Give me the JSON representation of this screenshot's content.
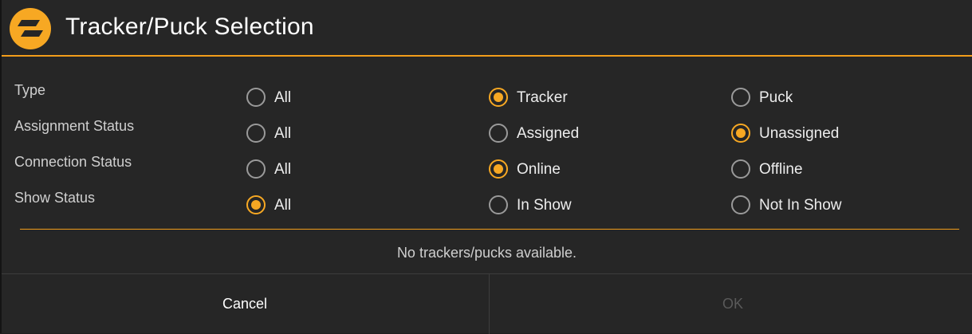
{
  "header": {
    "title": "Tracker/Puck Selection",
    "logo_icon": "app-logo-icon",
    "accent_color": "#f7a823"
  },
  "filters": [
    {
      "label": "Type",
      "options": [
        {
          "label": "All",
          "checked": false
        },
        {
          "label": "Tracker",
          "checked": true
        },
        {
          "label": "Puck",
          "checked": false
        }
      ]
    },
    {
      "label": "Assignment Status",
      "options": [
        {
          "label": "All",
          "checked": false
        },
        {
          "label": "Assigned",
          "checked": false
        },
        {
          "label": "Unassigned",
          "checked": true
        }
      ]
    },
    {
      "label": "Connection Status",
      "options": [
        {
          "label": "All",
          "checked": false
        },
        {
          "label": "Online",
          "checked": true
        },
        {
          "label": "Offline",
          "checked": false
        }
      ]
    },
    {
      "label": "Show Status",
      "options": [
        {
          "label": "All",
          "checked": true
        },
        {
          "label": "In Show",
          "checked": false
        },
        {
          "label": "Not In Show",
          "checked": false
        }
      ]
    }
  ],
  "list": {
    "empty_message": "No trackers/pucks available."
  },
  "footer": {
    "cancel_label": "Cancel",
    "ok_label": "OK",
    "ok_enabled": false
  }
}
